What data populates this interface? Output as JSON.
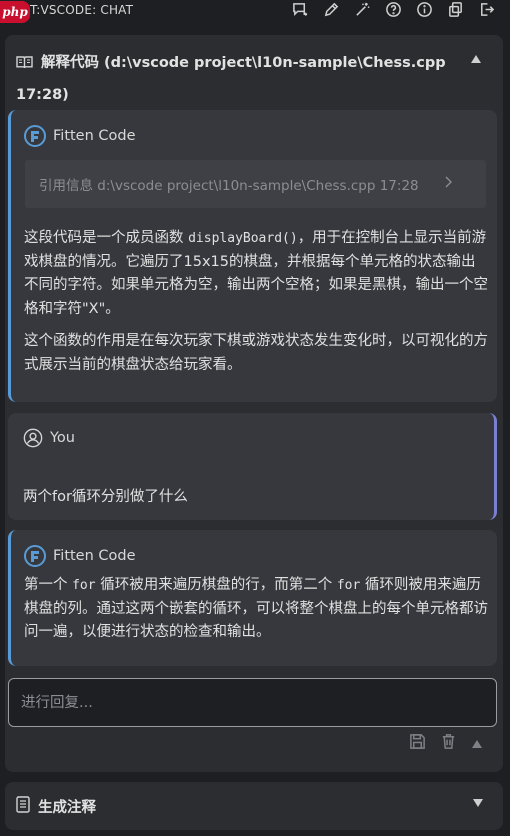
{
  "topbar": {
    "logo_text": "php",
    "title": "T:VSCODE: CHAT",
    "icons": [
      "new-chat-icon",
      "edit-icon",
      "magic-wand-icon",
      "help-icon",
      "info-icon",
      "copy-icon",
      "export-icon"
    ]
  },
  "panel": {
    "title": "解释代码 (d:\\vscode project\\l10n-sample\\Chess.cpp 17:28)",
    "icon": "book-icon"
  },
  "messages": [
    {
      "sender": "Fitten Code",
      "reference": "引用信息 d:\\vscode project\\l10n-sample\\Chess.cpp 17:28",
      "p1_a": "这段代码是一个成员函数 ",
      "p1_code": "displayBoard()",
      "p1_b": "，用于在控制台上显示当前游戏棋盘的情况。它遍历了15x15的棋盘，并根据每个单元格的状态输出不同的字符。如果单元格为空，输出两个空格；如果是黑棋，输出一个空格和字符\"X\"。",
      "p2": "这个函数的作用是在每次玩家下棋或游戏状态发生变化时，以可视化的方式展示当前的棋盘状态给玩家看。"
    },
    {
      "sender": "You",
      "text": "两个for循环分别做了什么"
    },
    {
      "sender": "Fitten Code",
      "p1_a": "第一个 ",
      "p1_code1": "for",
      "p1_b": " 循环被用来遍历棋盘的行，而第二个 ",
      "p1_code2": "for",
      "p1_c": " 循环则被用来遍历棋盘的列。通过这两个嵌套的循环，可以将整个棋盘上的每个单元格都访问一遍，以便进行状态的检查和输出。"
    }
  ],
  "reply": {
    "placeholder": "进行回复..."
  },
  "panel2": {
    "title": "生成注释",
    "icon": "document-icon"
  },
  "colors": {
    "background": "#1e1f22",
    "panel": "#2b2d31",
    "message": "#36383d",
    "ai_accent": "#5a9bd5",
    "user_accent": "#7b7fd1"
  }
}
